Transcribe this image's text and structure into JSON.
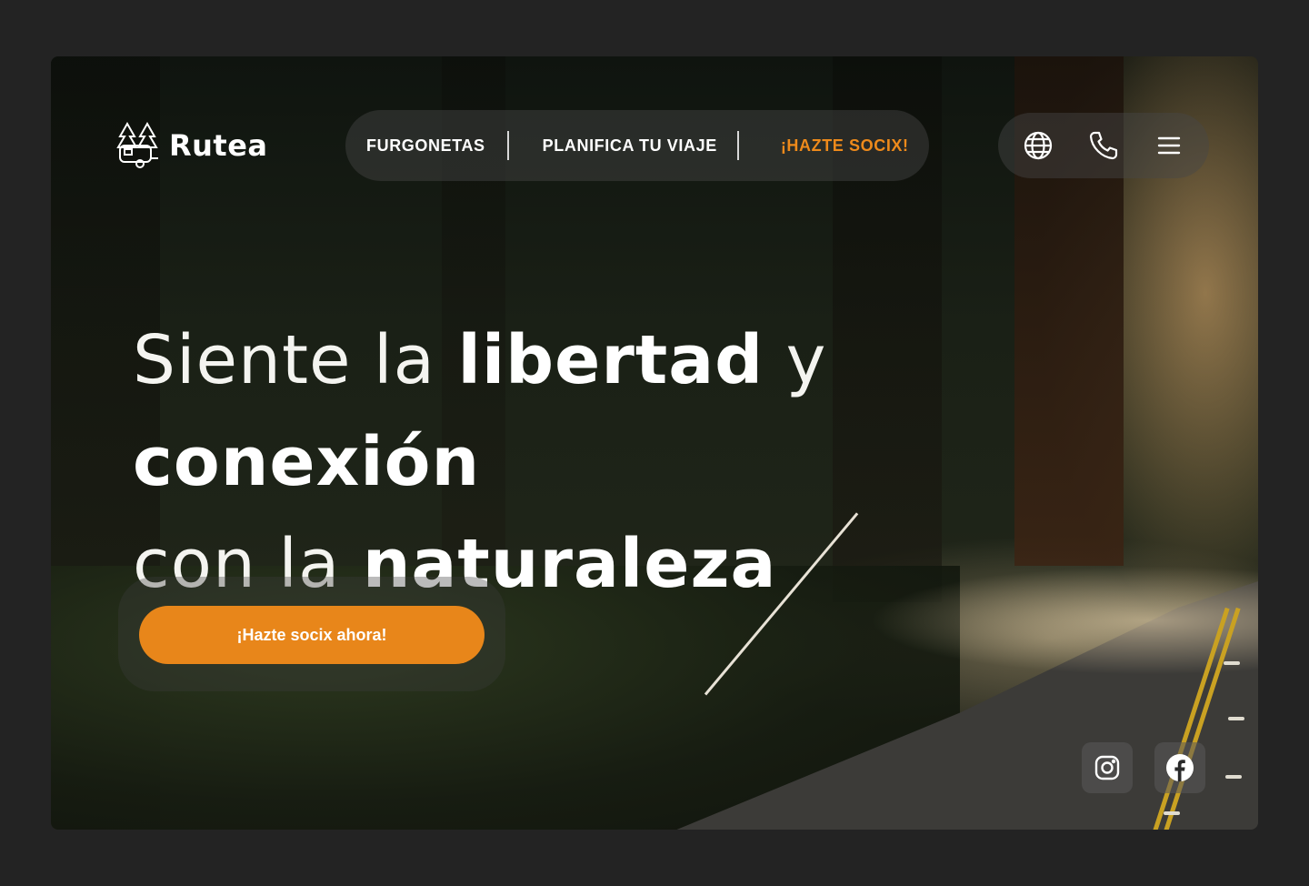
{
  "brand": {
    "name": "Rutea",
    "logo_icon": "trees-caravan-icon"
  },
  "nav": {
    "items": [
      {
        "label": "FURGONETAS",
        "accent": false
      },
      {
        "label": "PLANIFICA TU VIAJE",
        "accent": false
      },
      {
        "label": "¡HAZTE SOCIX!",
        "accent": true
      }
    ]
  },
  "header_icons": [
    {
      "name": "globe-icon"
    },
    {
      "name": "phone-icon"
    },
    {
      "name": "hamburger-menu-icon"
    }
  ],
  "hero": {
    "headline_parts": [
      {
        "text": "Siente la ",
        "bold": false
      },
      {
        "text": "libertad",
        "bold": true
      },
      {
        "text": " y ",
        "bold": false
      },
      {
        "text": "conexión",
        "bold": true
      },
      {
        "text": "con la ",
        "bold": false
      },
      {
        "text": "naturaleza",
        "bold": true
      }
    ],
    "cta_label": "¡Hazte socix ahora!"
  },
  "social": [
    {
      "name": "instagram-icon"
    },
    {
      "name": "facebook-icon"
    }
  ],
  "colors": {
    "accent": "#E8861A",
    "page_bg": "#232323",
    "text": "#FFFFFF"
  }
}
